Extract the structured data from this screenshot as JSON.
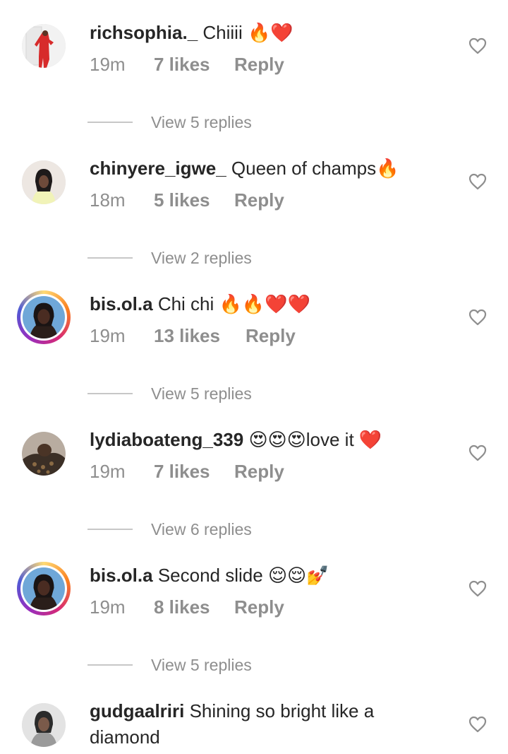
{
  "comments": [
    {
      "username": "richsophia._",
      "text": "Chiiii",
      "emoji": "🔥❤️",
      "time": "19m",
      "likes": "7 likes",
      "reply": "Reply",
      "view_replies": "View 5 replies"
    },
    {
      "username": "chinyere_igwe_",
      "text": "Queen of champs",
      "emoji": "🔥",
      "time": "18m",
      "likes": "5 likes",
      "reply": "Reply",
      "view_replies": "View 2 replies"
    },
    {
      "username": "bis.ol.a",
      "text": "Chi chi",
      "emoji": "🔥🔥❤️❤️",
      "time": "19m",
      "likes": "13 likes",
      "reply": "Reply",
      "view_replies": "View 5 replies"
    },
    {
      "username": "lydiaboateng_339",
      "text": "",
      "emoji": "😍😍😍",
      "text_after": "love it",
      "emoji_after": "❤️",
      "time": "19m",
      "likes": "7 likes",
      "reply": "Reply",
      "view_replies": "View 6 replies"
    },
    {
      "username": "bis.ol.a",
      "text": "Second slide",
      "emoji": "😌😌💅",
      "time": "19m",
      "likes": "8 likes",
      "reply": "Reply",
      "view_replies": "View 5 replies"
    },
    {
      "username": "gudgaalriri",
      "text": "Shining so bright like a diamond",
      "emoji": ""
    }
  ],
  "icons": {
    "like": "heart-outline-icon"
  },
  "colors": {
    "text": "#262626",
    "secondary": "#8e8e8e",
    "divider": "#c7c7c7"
  }
}
